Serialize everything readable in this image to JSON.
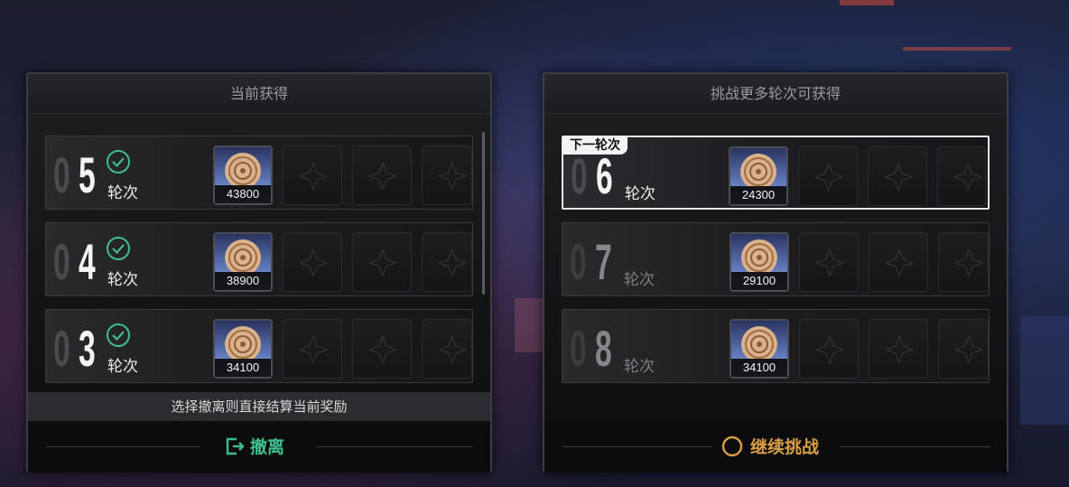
{
  "colors": {
    "accent_green": "#3fbe8b",
    "accent_gold": "#d8a046"
  },
  "left_panel": {
    "title": "当前获得",
    "rows": [
      {
        "num_prefix": "0",
        "num_digit": "5",
        "label": "轮次",
        "reward": "43800",
        "completed": true
      },
      {
        "num_prefix": "0",
        "num_digit": "4",
        "label": "轮次",
        "reward": "38900",
        "completed": true
      },
      {
        "num_prefix": "0",
        "num_digit": "3",
        "label": "轮次",
        "reward": "34100",
        "completed": true
      }
    ],
    "hint": "选择撤离则直接结算当前奖励",
    "action": {
      "label": "撤离",
      "icon": "exit-icon"
    }
  },
  "right_panel": {
    "title": "挑战更多轮次可获得",
    "next_badge": "下一轮次",
    "rows": [
      {
        "num_prefix": "0",
        "num_digit": "6",
        "label": "轮次",
        "reward": "24300",
        "active": true
      },
      {
        "num_prefix": "0",
        "num_digit": "7",
        "label": "轮次",
        "reward": "29100",
        "active": false
      },
      {
        "num_prefix": "0",
        "num_digit": "8",
        "label": "轮次",
        "reward": "34100",
        "active": false
      }
    ],
    "action": {
      "label": "继续挑战",
      "icon": "circle-icon"
    }
  }
}
